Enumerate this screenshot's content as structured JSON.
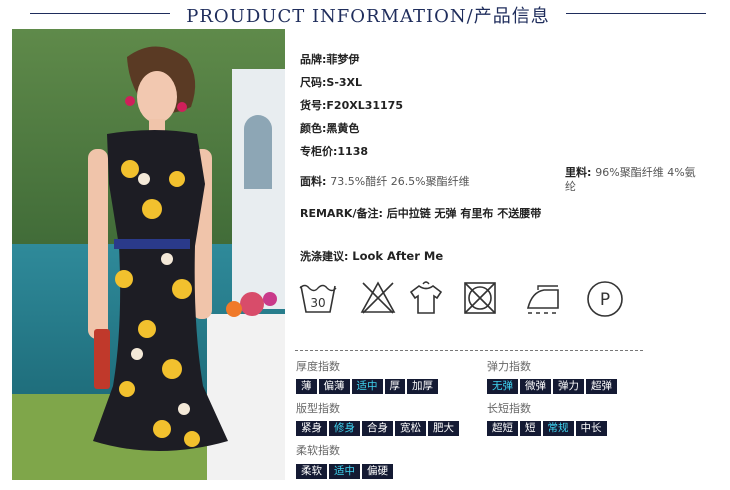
{
  "header": {
    "title": "PROUDUCT INFORMATION/产品信息"
  },
  "info": {
    "brand": {
      "label": "品牌:",
      "value": "菲梦伊"
    },
    "size": {
      "label": "尺码:",
      "value": "S-3XL"
    },
    "sku": {
      "label": "货号:",
      "value": "F20XL31175"
    },
    "color": {
      "label": "颜色:",
      "value": "黑黄色"
    },
    "price": {
      "label": "专柜价:",
      "value": "1138"
    },
    "fabric": {
      "label": "面料:",
      "value": "73.5%醋纤 26.5%聚酯纤维"
    },
    "lining": {
      "label": "里料:",
      "value": "96%聚酯纤维 4%氨纶"
    },
    "remark": {
      "label": "REMARK/备注:",
      "value": "后中拉链 无弹 有里布 不送腰带"
    }
  },
  "care": {
    "label": "洗涤建议:",
    "value": "Look After Me",
    "icons": [
      {
        "name": "wash-30-icon",
        "text": "30"
      },
      {
        "name": "no-bleach-icon",
        "text": ""
      },
      {
        "name": "hang-dry-icon",
        "text": ""
      },
      {
        "name": "no-tumble-dry-icon",
        "text": ""
      },
      {
        "name": "iron-low-icon",
        "text": ""
      },
      {
        "name": "dry-clean-p-icon",
        "text": "P"
      }
    ]
  },
  "indices": {
    "thickness": {
      "label": "厚度指数",
      "options": [
        "薄",
        "偏薄",
        "适中",
        "厚",
        "加厚"
      ],
      "selected": "适中"
    },
    "elasticity": {
      "label": "弹力指数",
      "options": [
        "无弹",
        "微弹",
        "弹力",
        "超弹"
      ],
      "selected": "无弹"
    },
    "fit": {
      "label": "版型指数",
      "options": [
        "紧身",
        "修身",
        "合身",
        "宽松",
        "肥大"
      ],
      "selected": "修身"
    },
    "length": {
      "label": "长短指数",
      "options": [
        "超短",
        "短",
        "常规",
        "中长"
      ],
      "selected": "常规"
    },
    "softness": {
      "label": "柔软指数",
      "options": [
        "柔软",
        "适中",
        "偏硬"
      ],
      "selected": "适中"
    }
  },
  "colors": {
    "header": "#1f2d5c",
    "chip_bg": "#141a33",
    "chip_text": "#ffffff",
    "chip_active": "#3fd4f0"
  }
}
